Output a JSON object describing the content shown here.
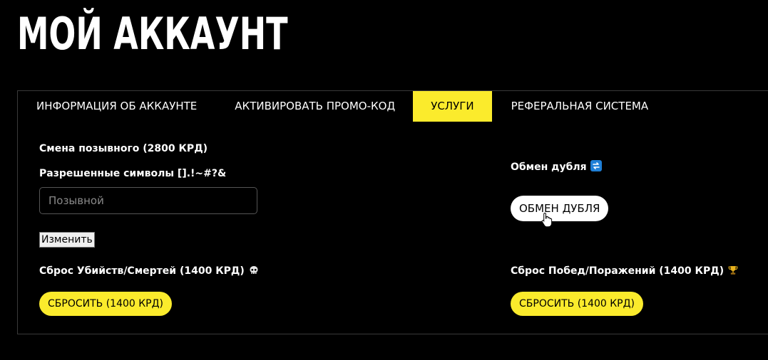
{
  "page": {
    "title": "МОЙ АККАУНТ"
  },
  "tabs": [
    {
      "label": "ИНФОРМАЦИЯ ОБ АККАУНТЕ",
      "active": false
    },
    {
      "label": "АКТИВИРОВАТЬ ПРОМО-КОД",
      "active": false
    },
    {
      "label": "УСЛУГИ",
      "active": true
    },
    {
      "label": "РЕФЕРАЛЬНАЯ СИСТЕМА",
      "active": false
    }
  ],
  "callsign": {
    "heading": "Смена позывного (2800 КРД)",
    "allowed_chars": "Разрешенные символы [].!~#?&",
    "input_value": "",
    "input_placeholder": "Позывной",
    "change_label": "Изменить"
  },
  "kd_reset": {
    "heading": "Сброс Убийств/Смертей (1400 КРД)",
    "icon": "skull-icon",
    "button_label": "СБРОСИТЬ (1400 КРД)"
  },
  "duplicate_exchange": {
    "heading": "Обмен дубля",
    "icon": "swap-icon",
    "button_label": "ОБМЕН ДУБЛЯ"
  },
  "wl_reset": {
    "heading": "Сброс Побед/Поражений (1400 КРД)",
    "icon": "trophy-icon",
    "button_label": "СБРОСИТЬ (1400 КРД)"
  },
  "colors": {
    "background": "#000000",
    "accent": "#fbeb2c",
    "text": "#ffffff",
    "border": "#3a3a3a"
  }
}
